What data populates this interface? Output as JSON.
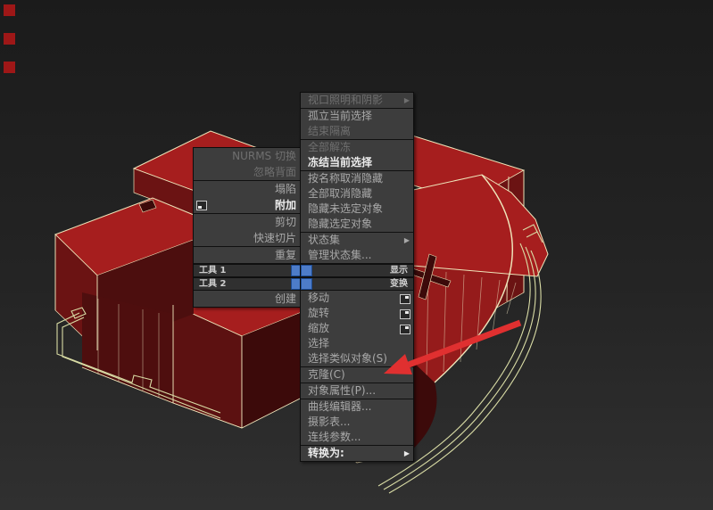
{
  "colors": {
    "accent": "#4d7cc9",
    "arrow": "#e03030",
    "roof": "#a61e1e",
    "wall_bright": "#951b1b",
    "wall_mid": "#6b1313",
    "wall_mid2": "#5c1111",
    "wall_dark": "#4c0e0e",
    "wall_dark2": "#4e0e0e",
    "wall_darker": "#3c0a0a",
    "edge": "#efe6bb",
    "site": "#d9dca5",
    "menu_bg": "#3d3d3d",
    "menu_text": "#a8a8a8",
    "menu_text_dim": "#6f6f6f",
    "menu_text_bright": "#ebebeb",
    "title_bg": "#303030",
    "marker_red": "#9e1717"
  },
  "icons": {
    "submenu": "▶"
  },
  "left_menu": {
    "groups": [
      {
        "items": [
          {
            "label": "NURMS 切换"
          },
          {
            "label": "忽略背面"
          }
        ]
      },
      {
        "items": [
          {
            "label": "塌陷"
          },
          {
            "label": "附加"
          }
        ]
      },
      {
        "items": [
          {
            "label": "剪切"
          },
          {
            "label": "快速切片"
          }
        ]
      },
      {
        "items": [
          {
            "label": "重复"
          }
        ]
      }
    ],
    "titles": [
      {
        "label": "工具 1"
      },
      {
        "label": "工具 2"
      }
    ],
    "bottom_groups": [
      {
        "items": [
          {
            "label": "创建"
          }
        ]
      }
    ]
  },
  "right_menu": {
    "groups": [
      {
        "items": [
          {
            "label": "视口照明和阴影"
          }
        ]
      },
      {
        "items": [
          {
            "label": "孤立当前选择"
          },
          {
            "label": "结束隔离"
          }
        ]
      },
      {
        "items": [
          {
            "label": "全部解冻"
          },
          {
            "label": "冻结当前选择"
          }
        ]
      },
      {
        "items": [
          {
            "label": "按名称取消隐藏"
          },
          {
            "label": "全部取消隐藏"
          },
          {
            "label": "隐藏未选定对象"
          },
          {
            "label": "隐藏选定对象"
          }
        ]
      },
      {
        "items": [
          {
            "label": "状态集"
          },
          {
            "label": "管理状态集..."
          }
        ]
      }
    ],
    "titles": [
      {
        "label": "显示"
      },
      {
        "label": "变换"
      }
    ],
    "bottom_groups": [
      {
        "items": [
          {
            "label": "移动"
          },
          {
            "label": "旋转"
          },
          {
            "label": "缩放"
          },
          {
            "label": "选择"
          },
          {
            "label": "选择类似对象(S)"
          }
        ]
      },
      {
        "items": [
          {
            "label": "克隆(C)"
          }
        ]
      },
      {
        "items": [
          {
            "label": "对象属性(P)..."
          }
        ]
      },
      {
        "items": [
          {
            "label": "曲线编辑器..."
          },
          {
            "label": "摄影表..."
          },
          {
            "label": "连线参数..."
          }
        ]
      },
      {
        "items": [
          {
            "label": "转换为:"
          }
        ]
      }
    ]
  },
  "annotation": {
    "arrow_points_to": "对象属性(P)..."
  }
}
